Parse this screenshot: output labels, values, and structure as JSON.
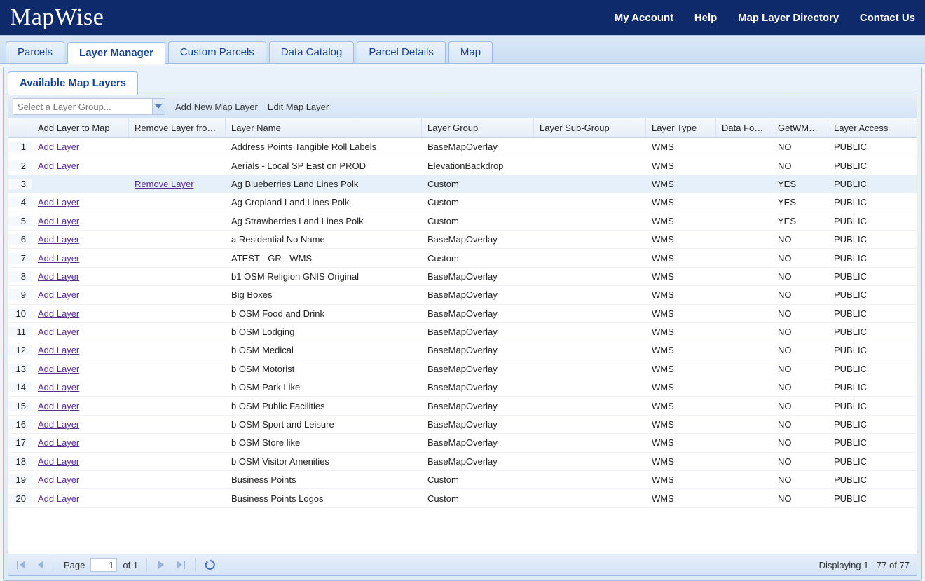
{
  "brand": "MapWise",
  "nav": {
    "my_account": "My Account",
    "help": "Help",
    "layer_dir": "Map Layer Directory",
    "contact": "Contact Us"
  },
  "tabs": {
    "parcels": "Parcels",
    "layer_manager": "Layer Manager",
    "custom_parcels": "Custom Parcels",
    "data_catalog": "Data Catalog",
    "parcel_details": "Parcel Details",
    "map": "Map"
  },
  "subtab": "Available Map Layers",
  "toolbar": {
    "combo_placeholder": "Select a Layer Group...",
    "add_new": "Add New Map Layer",
    "edit": "Edit Map Layer"
  },
  "columns": {
    "add": "Add Layer to Map",
    "remove": "Remove Layer fro…",
    "name": "Layer Name",
    "group": "Layer Group",
    "sub": "Layer Sub-Group",
    "type": "Layer Type",
    "df": "Data Fo…",
    "wms": "GetWM…",
    "access": "Layer Access"
  },
  "labels": {
    "add_link": "Add Layer",
    "remove_link": "Remove Layer"
  },
  "rows": [
    {
      "n": "1",
      "add": true,
      "rem": false,
      "name": "Address Points Tangible Roll Labels",
      "group": "BaseMapOverlay",
      "sub": "",
      "type": "WMS",
      "df": "",
      "wms": "NO",
      "acc": "PUBLIC",
      "sel": false
    },
    {
      "n": "2",
      "add": true,
      "rem": false,
      "name": "Aerials - Local SP East on PROD",
      "group": "ElevationBackdrop",
      "sub": "",
      "type": "WMS",
      "df": "",
      "wms": "NO",
      "acc": "PUBLIC",
      "sel": false
    },
    {
      "n": "3",
      "add": false,
      "rem": true,
      "name": "Ag Blueberries Land Lines Polk",
      "group": "Custom",
      "sub": "",
      "type": "WMS",
      "df": "",
      "wms": "YES",
      "acc": "PUBLIC",
      "sel": true
    },
    {
      "n": "4",
      "add": true,
      "rem": false,
      "name": "Ag Cropland Land Lines Polk",
      "group": "Custom",
      "sub": "",
      "type": "WMS",
      "df": "",
      "wms": "YES",
      "acc": "PUBLIC",
      "sel": false
    },
    {
      "n": "5",
      "add": true,
      "rem": false,
      "name": "Ag Strawberries Land Lines Polk",
      "group": "Custom",
      "sub": "",
      "type": "WMS",
      "df": "",
      "wms": "YES",
      "acc": "PUBLIC",
      "sel": false
    },
    {
      "n": "6",
      "add": true,
      "rem": false,
      "name": "a Residential No Name",
      "group": "BaseMapOverlay",
      "sub": "",
      "type": "WMS",
      "df": "",
      "wms": "NO",
      "acc": "PUBLIC",
      "sel": false
    },
    {
      "n": "7",
      "add": true,
      "rem": false,
      "name": "ATEST - GR - WMS",
      "group": "Custom",
      "sub": "",
      "type": "WMS",
      "df": "",
      "wms": "NO",
      "acc": "PUBLIC",
      "sel": false
    },
    {
      "n": "8",
      "add": true,
      "rem": false,
      "name": "b1 OSM Religion GNIS Original",
      "group": "BaseMapOverlay",
      "sub": "",
      "type": "WMS",
      "df": "",
      "wms": "NO",
      "acc": "PUBLIC",
      "sel": false
    },
    {
      "n": "9",
      "add": true,
      "rem": false,
      "name": "Big Boxes",
      "group": "BaseMapOverlay",
      "sub": "",
      "type": "WMS",
      "df": "",
      "wms": "NO",
      "acc": "PUBLIC",
      "sel": false
    },
    {
      "n": "10",
      "add": true,
      "rem": false,
      "name": "b OSM Food and Drink",
      "group": "BaseMapOverlay",
      "sub": "",
      "type": "WMS",
      "df": "",
      "wms": "NO",
      "acc": "PUBLIC",
      "sel": false
    },
    {
      "n": "11",
      "add": true,
      "rem": false,
      "name": "b OSM Lodging",
      "group": "BaseMapOverlay",
      "sub": "",
      "type": "WMS",
      "df": "",
      "wms": "NO",
      "acc": "PUBLIC",
      "sel": false
    },
    {
      "n": "12",
      "add": true,
      "rem": false,
      "name": "b OSM Medical",
      "group": "BaseMapOverlay",
      "sub": "",
      "type": "WMS",
      "df": "",
      "wms": "NO",
      "acc": "PUBLIC",
      "sel": false
    },
    {
      "n": "13",
      "add": true,
      "rem": false,
      "name": "b OSM Motorist",
      "group": "BaseMapOverlay",
      "sub": "",
      "type": "WMS",
      "df": "",
      "wms": "NO",
      "acc": "PUBLIC",
      "sel": false
    },
    {
      "n": "14",
      "add": true,
      "rem": false,
      "name": "b OSM Park Like",
      "group": "BaseMapOverlay",
      "sub": "",
      "type": "WMS",
      "df": "",
      "wms": "NO",
      "acc": "PUBLIC",
      "sel": false
    },
    {
      "n": "15",
      "add": true,
      "rem": false,
      "name": "b OSM Public Facilities",
      "group": "BaseMapOverlay",
      "sub": "",
      "type": "WMS",
      "df": "",
      "wms": "NO",
      "acc": "PUBLIC",
      "sel": false
    },
    {
      "n": "16",
      "add": true,
      "rem": false,
      "name": "b OSM Sport and Leisure",
      "group": "BaseMapOverlay",
      "sub": "",
      "type": "WMS",
      "df": "",
      "wms": "NO",
      "acc": "PUBLIC",
      "sel": false
    },
    {
      "n": "17",
      "add": true,
      "rem": false,
      "name": "b OSM Store like",
      "group": "BaseMapOverlay",
      "sub": "",
      "type": "WMS",
      "df": "",
      "wms": "NO",
      "acc": "PUBLIC",
      "sel": false
    },
    {
      "n": "18",
      "add": true,
      "rem": false,
      "name": "b OSM Visitor Amenities",
      "group": "BaseMapOverlay",
      "sub": "",
      "type": "WMS",
      "df": "",
      "wms": "NO",
      "acc": "PUBLIC",
      "sel": false
    },
    {
      "n": "19",
      "add": true,
      "rem": false,
      "name": "Business Points",
      "group": "Custom",
      "sub": "",
      "type": "WMS",
      "df": "",
      "wms": "NO",
      "acc": "PUBLIC",
      "sel": false
    },
    {
      "n": "20",
      "add": true,
      "rem": false,
      "name": "Business Points Logos",
      "group": "Custom",
      "sub": "",
      "type": "WMS",
      "df": "",
      "wms": "NO",
      "acc": "PUBLIC",
      "sel": false
    }
  ],
  "paging": {
    "page_label": "Page",
    "page_value": "1",
    "of_label": "of 1",
    "display": "Displaying 1 - 77 of 77"
  }
}
